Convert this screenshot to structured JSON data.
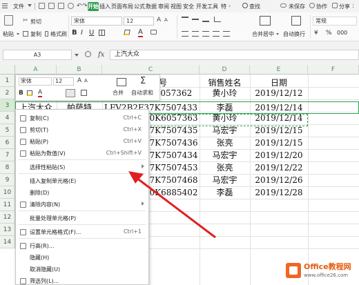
{
  "menubar": {
    "file": "文件",
    "tabs": [
      "开始",
      "插入",
      "页面布局",
      "公式",
      "数据",
      "审阅",
      "视图",
      "安全",
      "开发工具",
      "特"
    ],
    "search": "查找",
    "unsaved": "未保存",
    "collaborate": "协作",
    "share": "分享"
  },
  "ribbon": {
    "paste": "粘贴",
    "cut": "剪切",
    "copy": "复制",
    "format_painter": "格式刷",
    "font_name": "宋体",
    "font_size": "12",
    "merge_center": "合并居中",
    "wrap_text": "自动换行",
    "number_format": "常规",
    "currency_symbol": "¥",
    "percent_symbol": "%",
    "thousands_symbol": "000"
  },
  "formulabar": {
    "namebox": "A3",
    "fx": "fx",
    "content": "上汽大众"
  },
  "grid": {
    "columns": [
      "A",
      "B",
      "C",
      "D",
      "E",
      "F"
    ],
    "rows": [
      "1",
      "2",
      "3",
      "4",
      "5",
      "6",
      "7",
      "8",
      "9",
      "10",
      "11",
      "12",
      "13",
      "14"
    ],
    "header_fragment": "号",
    "col_d_header": "销售姓名",
    "col_e_header": "日期",
    "row3": {
      "a": "上汽大众",
      "b": "帕萨特",
      "c": "LFV2B2F37K7507433",
      "d": "李磊",
      "e": "2019/12/14"
    },
    "c_partials": [
      "6057362",
      "0K6057363",
      "7K7507435",
      "7K7507436",
      "7K7507434",
      "7K7507453",
      "7K7507468",
      "0K6885402"
    ],
    "names": [
      "黄小玲",
      "黄小玲",
      "马宏宇",
      "张亮",
      "马宏宇",
      "张亮",
      "马宏宇",
      "李磊"
    ],
    "dates": [
      "2019/12/12",
      "2019/12/14",
      "2019/12/15",
      "2019/12/15",
      "2019/12/20",
      "2019/12/22",
      "2019/12/26",
      "2019/12/28"
    ]
  },
  "minitoolbar": {
    "font_name": "宋体",
    "font_size": "12",
    "merge": "合并",
    "autosum": "自动求和"
  },
  "context_menu": {
    "items": [
      {
        "label": "复制(C)",
        "shortcut": "Ctrl+C"
      },
      {
        "label": "剪切(T)",
        "shortcut": "Ctrl+X"
      },
      {
        "label": "粘贴(P)",
        "shortcut": "Ctrl+V"
      },
      {
        "label": "粘贴为数值(V)",
        "shortcut": "Ctrl+Shift+V"
      },
      {
        "label": "选择性粘贴(S)",
        "shortcut": ""
      },
      {
        "label": "插入复制单元格(E)",
        "shortcut": ""
      },
      {
        "label": "删除(D)",
        "shortcut": ""
      },
      {
        "label": "清除内容(N)",
        "shortcut": ""
      },
      {
        "label": "批量处理单元格(P)",
        "shortcut": ""
      },
      {
        "label": "设置单元格格式(F)...",
        "shortcut": "Ctrl+1"
      },
      {
        "label": "行高(R)...",
        "shortcut": ""
      },
      {
        "label": "隐藏(H)",
        "shortcut": ""
      },
      {
        "label": "取消隐藏(U)",
        "shortcut": ""
      },
      {
        "label": "筛选列(L)...",
        "shortcut": ""
      }
    ]
  },
  "watermark": {
    "brand": "Office教程网",
    "url": "www.office26.com"
  },
  "colors": {
    "accent_green": "#2e9e4f",
    "arrow_red": "#e02020",
    "selection_green": "#2e9e4f"
  }
}
